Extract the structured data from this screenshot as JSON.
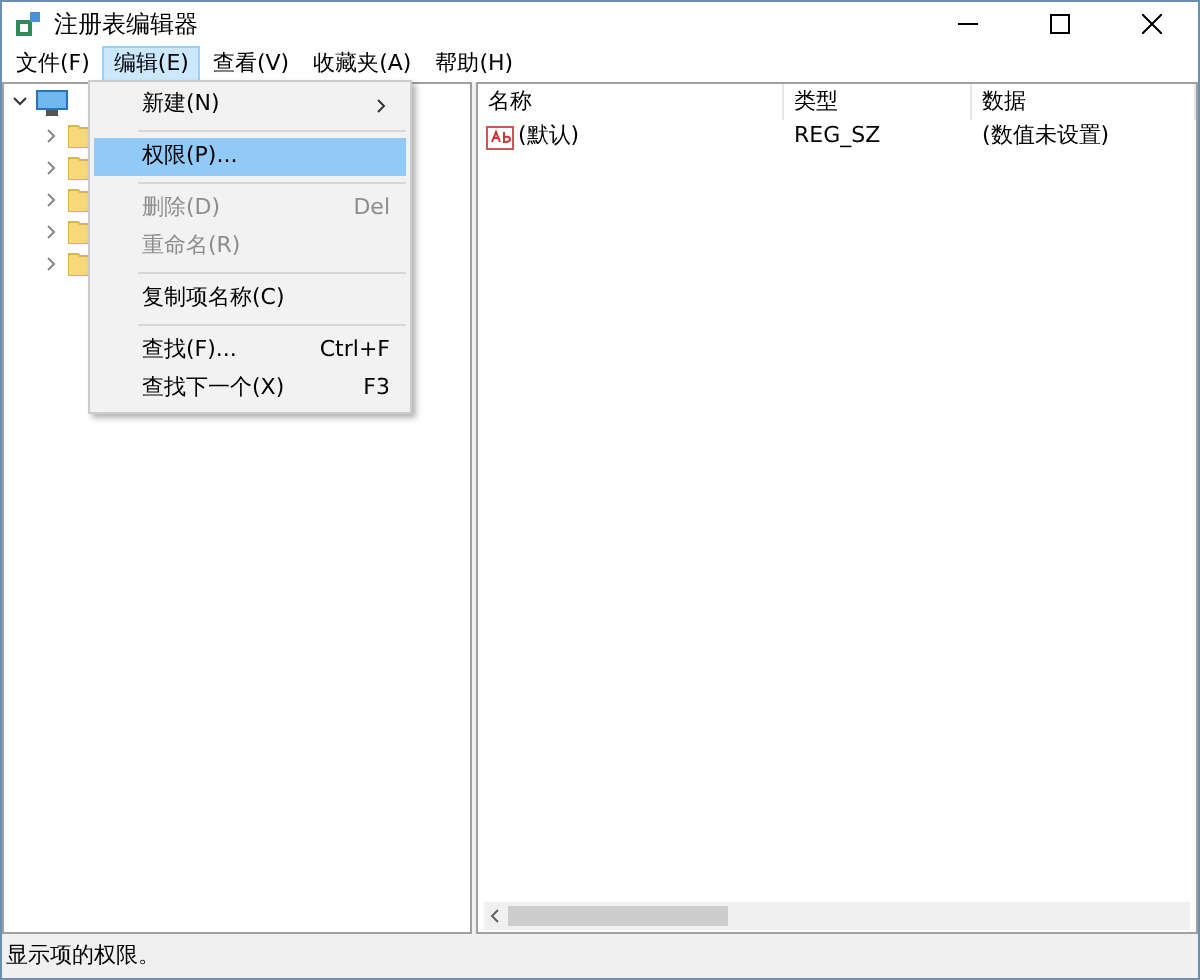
{
  "window": {
    "title": "注册表编辑器"
  },
  "menu_bar": [
    {
      "label": "文件(F)",
      "selected": false
    },
    {
      "label": "编辑(E)",
      "selected": true
    },
    {
      "label": "查看(V)",
      "selected": false
    },
    {
      "label": "收藏夹(A)",
      "selected": false
    },
    {
      "label": "帮助(H)",
      "selected": false
    }
  ],
  "tree": {
    "expanded": true,
    "children": [
      {
        "expanded": false
      },
      {
        "expanded": false
      },
      {
        "expanded": false
      },
      {
        "expanded": false
      },
      {
        "expanded": false
      }
    ]
  },
  "edit_menu": [
    {
      "kind": "item",
      "label": "新建(N)",
      "submenu": true,
      "selected": false,
      "disabled": false
    },
    {
      "kind": "separator"
    },
    {
      "kind": "item",
      "label": "权限(P)...",
      "selected": true,
      "disabled": false
    },
    {
      "kind": "separator"
    },
    {
      "kind": "item",
      "label": "删除(D)",
      "shortcut": "Del",
      "selected": false,
      "disabled": true
    },
    {
      "kind": "item",
      "label": "重命名(R)",
      "selected": false,
      "disabled": true
    },
    {
      "kind": "separator"
    },
    {
      "kind": "item",
      "label": "复制项名称(C)",
      "selected": false,
      "disabled": false
    },
    {
      "kind": "separator"
    },
    {
      "kind": "item",
      "label": "查找(F)...",
      "shortcut": "Ctrl+F",
      "selected": false,
      "disabled": false
    },
    {
      "kind": "item",
      "label": "查找下一个(X)",
      "shortcut": "F3",
      "selected": false,
      "disabled": false
    }
  ],
  "table": {
    "columns": [
      "名称",
      "类型",
      "数据"
    ],
    "rows": [
      {
        "name": "(默认)",
        "type": "REG_SZ",
        "data": "(数值未设置)"
      }
    ]
  },
  "status_bar": "显示项的权限。"
}
